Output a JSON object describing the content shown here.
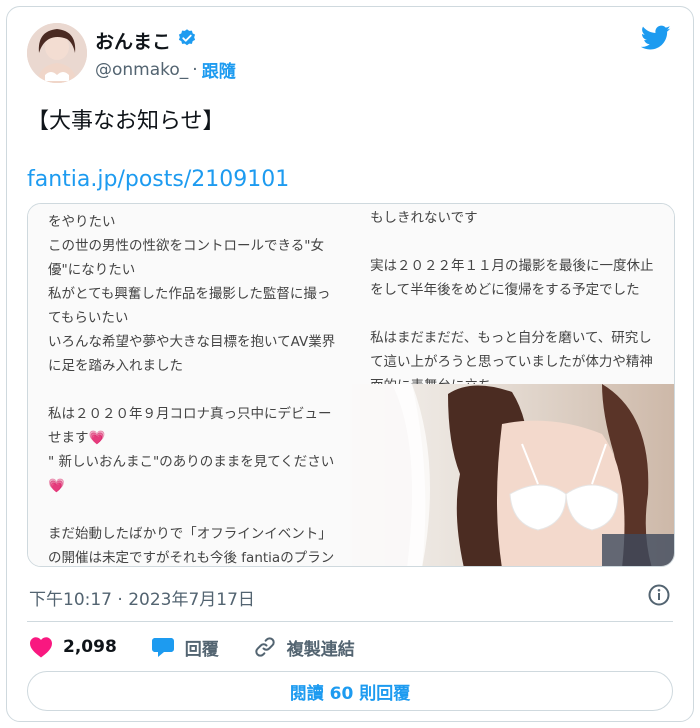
{
  "user": {
    "display_name": "おんまこ",
    "handle": "@onmako_",
    "separator": "·",
    "follow_label": "跟隨"
  },
  "tweet": {
    "text": "【大事なお知らせ】",
    "link": "fantia.jp/posts/2109101"
  },
  "media": {
    "left_text": "をやりたい\nこの世の男性の性欲をコントロールできる\"女優\"になりたい\n私がとても興奮した作品を撮影した監督に撮ってもらいたい\nいろんな希望や夢や大きな目標を抱いてAV業界に足を踏み入れました\n\n私は２０２０年９月コロナ真っ只中にデビューせます💗\n\" 新しいおんまこ\"のありのままを見てください💗\n\nまだ始動したばかりで「オフラインイベント」の開催は未定ですがそれも今後 fantiaのプランに入れたり、おんまこと電話できたり、毎日 LINEできちゃったり、、貴方だけのリクエスト動画をつくったりなど色々考えてます💗",
    "right_text": "もしきれないです\n\n実は２０２２年１１月の撮影を最後に一度休止をして半年後をめどに復帰をする予定でした\n\n私はまだまだだ、もっと自分を磨いて、研究して這い上がろうと思っていましたが体力や精神面的に表舞台に立ち\n自分を表現することが難しくなってしまいまし"
  },
  "timestamp": "下午10:17 · 2023年7月17日",
  "actions": {
    "likes": "2,098",
    "reply_label": "回覆",
    "copy_link_label": "複製連結"
  },
  "replies_button": "閱讀 60 則回覆",
  "colors": {
    "accent": "#1d9bf0",
    "like": "#f91880",
    "border": "#cfd9de",
    "muted": "#536471"
  },
  "icons": [
    "verified-badge-icon",
    "twitter-bird-icon",
    "info-icon",
    "heart-icon",
    "reply-bubble-icon",
    "link-icon"
  ]
}
